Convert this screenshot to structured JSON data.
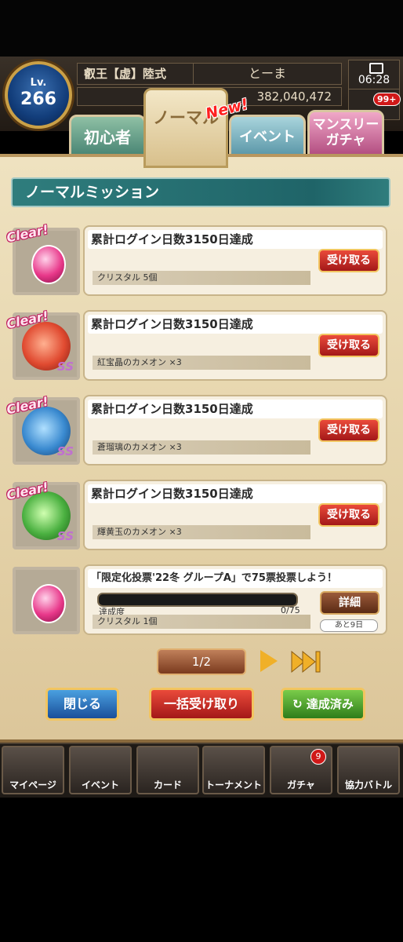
{
  "header": {
    "level_label": "Lv.",
    "level": "266",
    "title": "叡王【虚】陸式",
    "name": "とーま",
    "currency": "382,040,472",
    "time": "06:28",
    "notification_badge": "99+"
  },
  "tabs": [
    {
      "label": "初心者"
    },
    {
      "label": "ノーマル"
    },
    {
      "label": "イベント"
    },
    {
      "label": "マンスリー\nガチャ"
    }
  ],
  "new_tag": "New!",
  "section_title": "ノーマルミッション",
  "clear_tag": "Clear!",
  "ss_mark": "SS",
  "missions": [
    {
      "title": "累計ログイン日数3150日達成",
      "reward": "クリスタル 5個",
      "button": "受け取る",
      "icon": "crystal-icon",
      "color": "#e8388a"
    },
    {
      "title": "累計ログイン日数3150日達成",
      "reward": "紅宝晶のカメオン ×3",
      "button": "受け取る",
      "icon": "red-chameleon-icon",
      "color": "#e04a30"
    },
    {
      "title": "累計ログイン日数3150日達成",
      "reward": "蒼瑠璃のカメオン ×3",
      "button": "受け取る",
      "icon": "blue-chameleon-icon",
      "color": "#3a8ad0"
    },
    {
      "title": "累計ログイン日数3150日達成",
      "reward": "輝黄玉のカメオン ×3",
      "button": "受け取る",
      "icon": "green-chameleon-icon",
      "color": "#4ab040"
    },
    {
      "title": "「限定化投票'22冬 グループA」で75票投票しよう！",
      "reward": "クリスタル 1個",
      "button": "詳細",
      "icon": "crystal-icon",
      "progress_label": "達成度",
      "progress_value": "0/75",
      "progress": 0,
      "days_left": "あと9日"
    }
  ],
  "pager": {
    "label": "1/2"
  },
  "buttons": {
    "close": "閉じる",
    "receive_all": "一括受け取り",
    "completed": "達成済み"
  },
  "nav": [
    {
      "label": "マイページ"
    },
    {
      "label": "イベント"
    },
    {
      "label": "カード"
    },
    {
      "label": "トーナメント"
    },
    {
      "label": "ガチャ",
      "badge": "9"
    },
    {
      "label": "協力バトル"
    }
  ]
}
